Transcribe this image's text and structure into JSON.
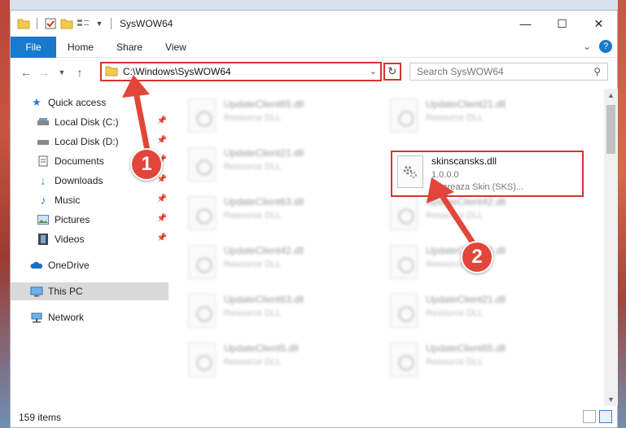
{
  "window": {
    "title": "SysWOW64"
  },
  "controls": {
    "minimize": "—",
    "maximize": "☐",
    "close": "✕"
  },
  "ribbon": {
    "tabs": [
      "File",
      "Home",
      "Share",
      "View"
    ],
    "expand": "⌄",
    "help": "?"
  },
  "address": {
    "path": "C:\\Windows\\SysWOW64",
    "search_placeholder": "Search SysWOW64"
  },
  "nav": {
    "quick_access": "Quick access",
    "items": [
      {
        "label": "Local Disk (C:)"
      },
      {
        "label": "Local Disk (D:)"
      },
      {
        "label": "Documents"
      },
      {
        "label": "Downloads"
      },
      {
        "label": "Music"
      },
      {
        "label": "Pictures"
      },
      {
        "label": "Videos"
      }
    ],
    "onedrive": "OneDrive",
    "this_pc": "This PC",
    "network": "Network"
  },
  "files": {
    "left_column": [
      {
        "name": "UpdateClient65.dll",
        "desc": "Resource DLL"
      },
      {
        "name": "UpdateClient21.dll",
        "desc": "Resource DLL"
      },
      {
        "name": "UpdateClient63.dll",
        "desc": "Resource DLL"
      },
      {
        "name": "UpdateClient42.dll",
        "desc": "Resource DLL"
      },
      {
        "name": "UpdateClient63.dll",
        "desc": "Resource DLL"
      },
      {
        "name": "UpdateClient5.dll",
        "desc": "Resource DLL"
      }
    ],
    "right_column": [
      {
        "name": "UpdateClient21.dll",
        "desc": "Resource DLL"
      },
      {
        "name": "UpdateClient42.dll",
        "desc": "Resource DLL"
      },
      {
        "name": "UpdateClient63.dll",
        "desc": "Resource DLL"
      },
      {
        "name": "UpdateClient21.dll",
        "desc": "Resource DLL"
      },
      {
        "name": "UpdateClient65.dll",
        "desc": "Resource DLL"
      }
    ],
    "selected": {
      "name": "skinscansks.dll",
      "version": "1.0.0.0",
      "desc": "Shareaza Skin (SKS)..."
    }
  },
  "status": {
    "count": "159 items"
  },
  "annotations": {
    "step1": "1",
    "step2": "2",
    "color": "#e2453a"
  }
}
